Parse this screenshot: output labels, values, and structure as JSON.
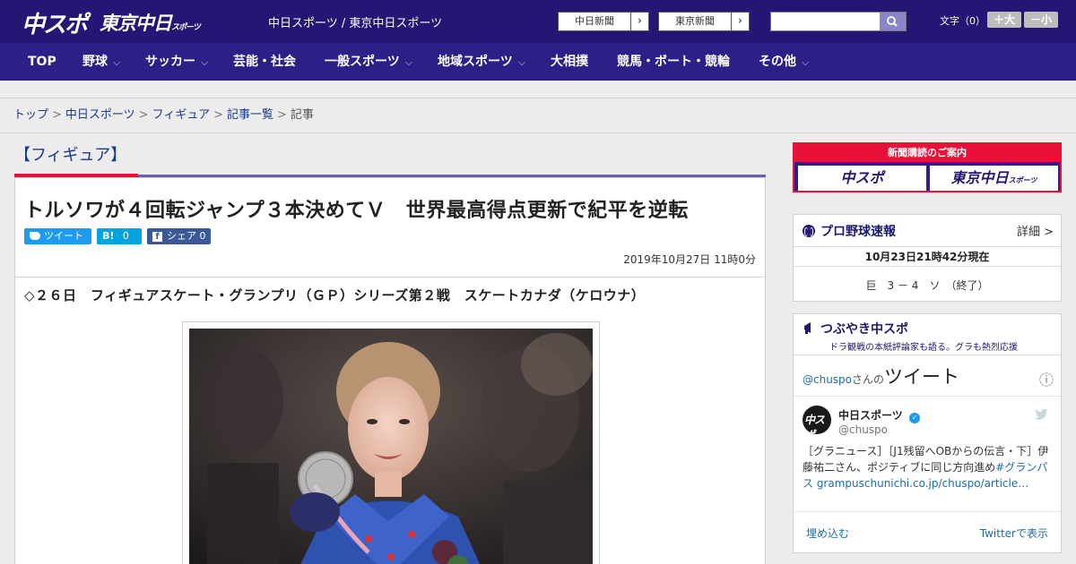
{
  "header": {
    "logo_chuspo": "中スポ",
    "logo_tokyo": "東京中日",
    "logo_tokyo_small": "スポーツ",
    "site_links": "中日スポーツ / 東京中日スポーツ",
    "paper_buttons": [
      {
        "label": "中日新聞",
        "arrow": "›"
      },
      {
        "label": "東京新聞",
        "arrow": "›"
      }
    ],
    "search": {
      "placeholder": ""
    },
    "font_size_label": "文字（0）",
    "font_plus": "＋大",
    "font_minus": "－小"
  },
  "nav": {
    "items": [
      {
        "label": "TOP",
        "has_menu": false
      },
      {
        "label": "野球",
        "has_menu": true
      },
      {
        "label": "サッカー",
        "has_menu": true
      },
      {
        "label": "芸能・社会",
        "has_menu": false
      },
      {
        "label": "一般スポーツ",
        "has_menu": true
      },
      {
        "label": "地域スポーツ",
        "has_menu": true
      },
      {
        "label": "大相撲",
        "has_menu": false
      },
      {
        "label": "競馬・ボート・競輪",
        "has_menu": false
      },
      {
        "label": "その他",
        "has_menu": true
      }
    ]
  },
  "breadcrumb": {
    "items": [
      "トップ",
      "中日スポーツ",
      "フィギュア",
      "記事一覧"
    ],
    "current": "記事",
    "separator": ">"
  },
  "category": {
    "title": "【フィギュア】"
  },
  "article": {
    "title": "トルソワが４回転ジャンプ３本決めてＶ　世界最高得点更新で紀平を逆転",
    "tweet_label": "ツイート",
    "hatena_label": "B!",
    "hatena_count": "0",
    "facebook_label": "シェア",
    "facebook_count": "0",
    "date": "2019年10月27日 11時0分",
    "lead": "◇２６日　フィギュアスケート・グランプリ（ＧＰ）シリーズ第２戦　スケートカナダ（ケロウナ）"
  },
  "sidebar": {
    "subscribe": {
      "title": "新聞購読のご案内",
      "buttons": [
        "中スポ",
        "東京中日"
      ],
      "tokyo_small": "スポーツ"
    },
    "baseball": {
      "title": "プロ野球速報",
      "detail": "詳細 >",
      "timestamp": "10月23日21時42分現在",
      "score": "巨　3 － 4　ソ　（終了）"
    },
    "tweets": {
      "title": "つぶやき中スポ",
      "subtitle": "ドラ観戦の本紙評論家も語る。グラも熱烈応援",
      "header_handle": "@chuspo",
      "header_san": "さんの",
      "header_tweet": "ツイート",
      "info_icon": "ⓘ",
      "author_name": "中日スポーツ",
      "author_handle": "@chuspo",
      "tweet_text_plain": "［グラニュース］［J1残留へOBからの伝言・下］伊藤祐二さん、ポジティブに同じ方向進め",
      "tweet_text_link": "#グランパス grampuschunichi.co.jp/chuspo/article…",
      "footer_embed": "埋め込む",
      "footer_view": "Twitterで表示"
    }
  },
  "colors": {
    "header_bg": "#231675",
    "nav_bg": "#2c1f86",
    "accent_red": "#e8113a",
    "link_blue": "#1a3a8a",
    "twitter_blue": "#1d9bf0"
  }
}
